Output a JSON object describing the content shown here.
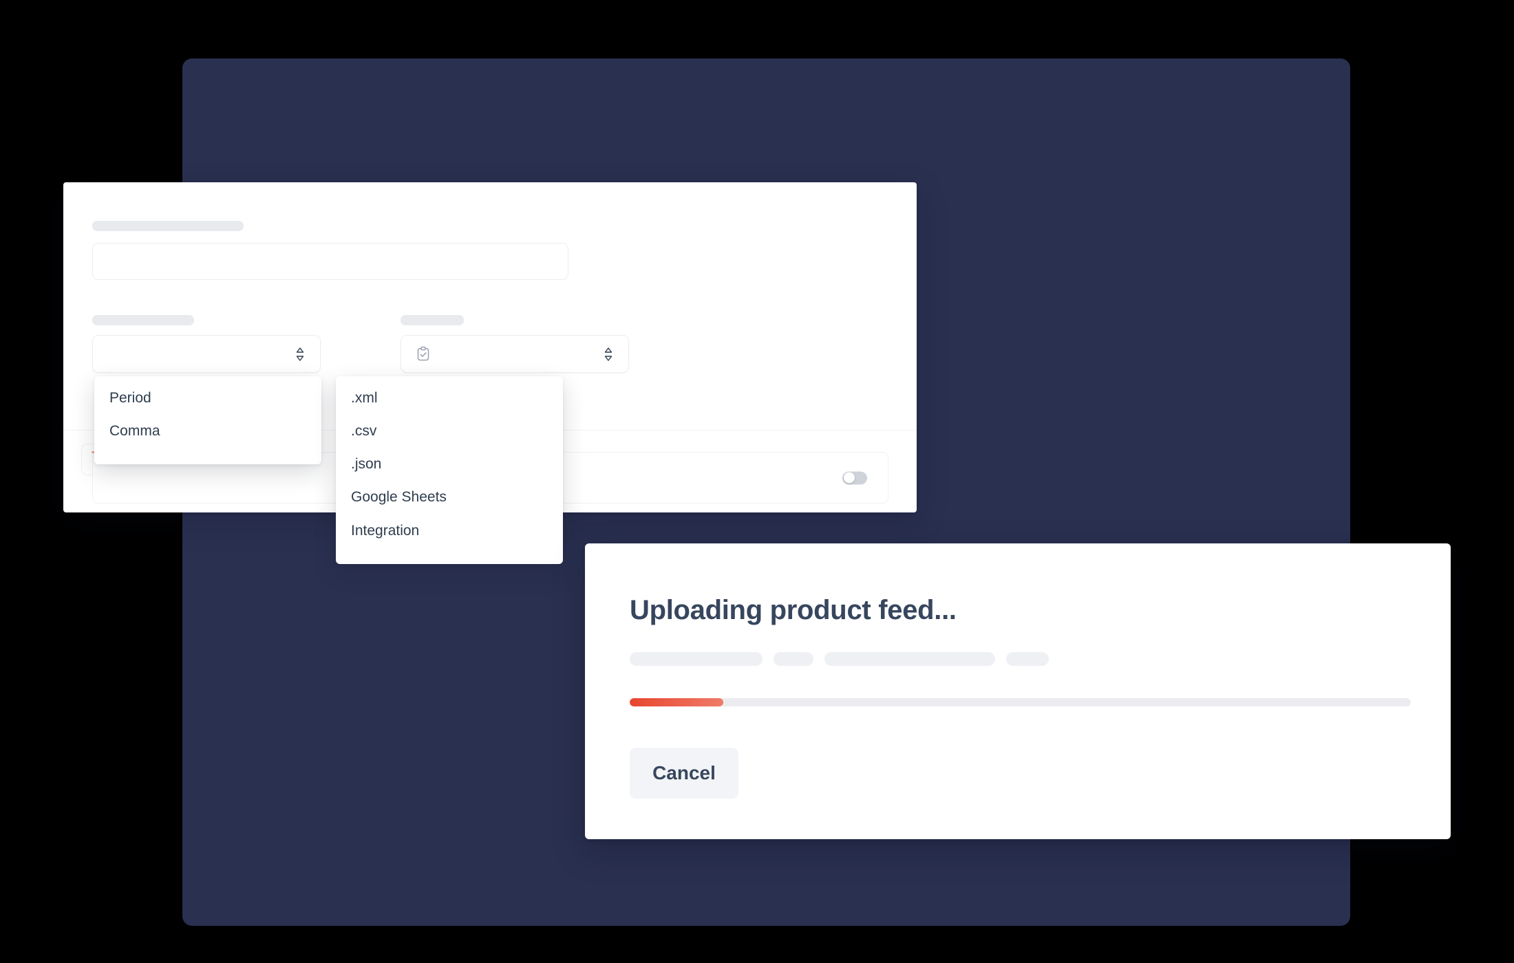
{
  "theme": {
    "panel_bg": "#2a3050",
    "card_bg": "#ffffff",
    "accent_start": "#e8462f",
    "accent_end": "#ef7b68",
    "text_dark": "#37465e",
    "skeleton": "#e8eaee",
    "skeleton_light": "#eef0f3"
  },
  "form_card": {
    "fields": {
      "feed_name_label": "",
      "feed_name_value": "",
      "separator_label": "",
      "separator_value": "",
      "filetype_label": "",
      "filetype_value": "",
      "filetype_icon": "clipboard-check-icon",
      "toggle_state": "off"
    }
  },
  "dropdowns": {
    "separator": {
      "options": [
        "Period",
        "Comma"
      ]
    },
    "filetype": {
      "options": [
        ".xml",
        ".csv",
        ".json",
        "Google Sheets",
        "Integration"
      ]
    }
  },
  "upload_dialog": {
    "title": "Uploading product feed...",
    "progress_percent": 12,
    "cancel_label": "Cancel"
  }
}
